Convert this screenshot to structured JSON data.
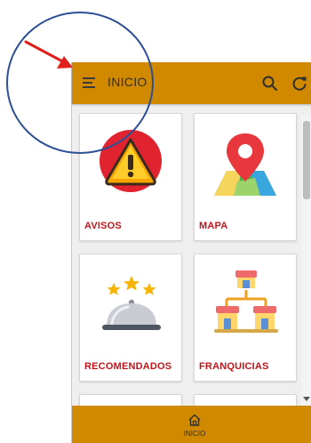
{
  "header": {
    "title": "INICIO",
    "menu_icon": "menu-icon",
    "search_icon": "search-icon",
    "refresh_icon": "refresh-icon"
  },
  "cards": [
    {
      "label": "AVISOS",
      "icon": "warning-icon"
    },
    {
      "label": "MAPA",
      "icon": "map-pin-icon"
    },
    {
      "label": "RECOMENDADOS",
      "icon": "cloche-stars-icon"
    },
    {
      "label": "FRANQUICIAS",
      "icon": "stores-network-icon"
    }
  ],
  "bottom_nav": {
    "label": "INICIO",
    "icon": "home-icon"
  },
  "colors": {
    "appbar": "#d18a00",
    "card_label": "#c0161b",
    "annotation_circle": "#2d4f94",
    "annotation_arrow": "#e0201c"
  }
}
